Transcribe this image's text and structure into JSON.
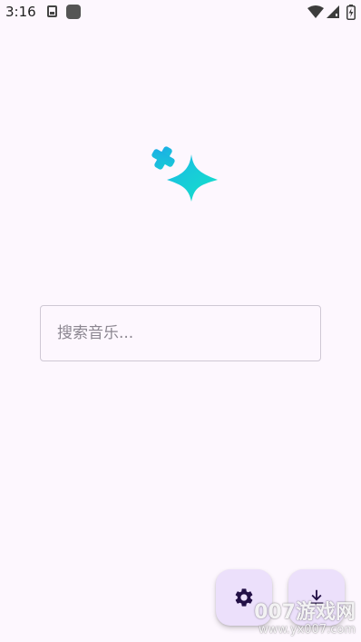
{
  "status_bar": {
    "time": "3:16",
    "icons": [
      "accessibility-icon",
      "app-square-icon",
      "wifi-icon",
      "signal-icon",
      "battery-icon"
    ]
  },
  "logo": {
    "icon": "sparkle-icon",
    "colors": {
      "start": "#1bb8e6",
      "end": "#14e3c8"
    }
  },
  "search": {
    "placeholder": "搜索音乐...",
    "value": ""
  },
  "actions": {
    "settings_icon": "gear-icon",
    "download_icon": "download-icon"
  },
  "watermark": {
    "title": "007游戏网",
    "url": "www.yx007.com"
  },
  "colors": {
    "background": "#fdf7fe",
    "fab_background": "#ece0fb",
    "fab_icon": "#231046",
    "field_border": "#cfc8d4"
  }
}
